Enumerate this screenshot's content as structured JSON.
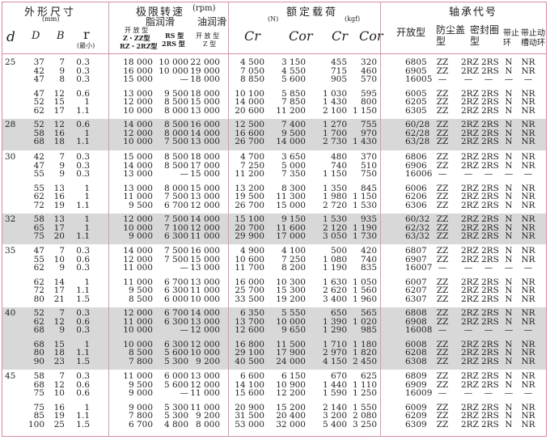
{
  "header": {
    "dims_title": "外形尺寸",
    "dims_unit": "(mm)",
    "d": "d",
    "D": "D",
    "B": "B",
    "r": "r",
    "r_note": "(最小)",
    "speed_title": "极限转速",
    "speed_unit": "(rpm)",
    "grease": "脂润滑",
    "oil": "油润滑",
    "grease_open": "开 放 型",
    "grease_zz": "Z・ZZ型",
    "grease_rz": "RZ・2RZ型",
    "rs_type": "RS 型",
    "rs2_type": "2RS 型",
    "oil_open": "开 放 型",
    "oil_z": "Z 型",
    "load_title": "额定载荷",
    "load_unit_n": "(N)",
    "load_unit_kgf": "(kgf)",
    "cr": "Cr",
    "cor": "Cor",
    "cr2": "Cr",
    "cor2": "Cor",
    "code_title": "轴承代号",
    "open_type": "开放型",
    "dust_cover": "防尘盖型",
    "seal_ring": "密封圈型",
    "snap_ring": "带止环",
    "snap_groove": "带止动槽动环"
  },
  "groups": [
    {
      "d": "25",
      "rows": [
        [
          "37",
          "7",
          "0.3",
          "18 000",
          "10 000",
          "22 000",
          "4 500",
          "3 150",
          "455",
          "320",
          "6805",
          "ZZ",
          "2RZ",
          "2RS",
          "N",
          "NR"
        ],
        [
          "42",
          "9",
          "0.3",
          "16 000",
          "10 000",
          "19 000",
          "7 050",
          "4 550",
          "715",
          "460",
          "6905",
          "ZZ",
          "2RZ",
          "2RS",
          "N",
          "NR"
        ],
        [
          "47",
          "8",
          "0.3",
          "15 000",
          "—",
          "18 000",
          "8 850",
          "5 600",
          "905",
          "570",
          "16005",
          "—",
          "—",
          "—",
          "—",
          "—"
        ],
        [
          "47",
          "12",
          "0.6",
          "13 000",
          "9 500",
          "18 000",
          "10 100",
          "5 850",
          "1 030",
          "595",
          "6005",
          "ZZ",
          "2RZ",
          "2RS",
          "N",
          "NR"
        ],
        [
          "52",
          "15",
          "1",
          "12 000",
          "8 500",
          "15 000",
          "14 000",
          "7 850",
          "1 430",
          "800",
          "6205",
          "ZZ",
          "2RZ",
          "2RS",
          "N",
          "NR"
        ],
        [
          "62",
          "17",
          "1.1",
          "10 000",
          "8 000",
          "13 000",
          "20 600",
          "11 200",
          "2 100",
          "1 150",
          "6305",
          "ZZ",
          "2RZ",
          "2RS",
          "N",
          "NR"
        ]
      ]
    },
    {
      "d": "28",
      "rows": [
        [
          "52",
          "12",
          "0.6",
          "14 000",
          "8 500",
          "16 000",
          "12 500",
          "7 400",
          "1 270",
          "755",
          "60/28",
          "ZZ",
          "2RZ",
          "2RS",
          "N",
          "NR"
        ],
        [
          "58",
          "16",
          "1",
          "12 000",
          "8 000",
          "14 000",
          "16 600",
          "9 500",
          "1 700",
          "970",
          "62/28",
          "ZZ",
          "2RZ",
          "2RS",
          "N",
          "NR"
        ],
        [
          "68",
          "18",
          "1.1",
          "10 000",
          "7 500",
          "13 000",
          "26 700",
          "14 000",
          "2 730",
          "1 430",
          "63/28",
          "ZZ",
          "2RZ",
          "2RS",
          "N",
          "NR"
        ]
      ]
    },
    {
      "d": "30",
      "rows": [
        [
          "42",
          "7",
          "0.3",
          "15 000",
          "8 500",
          "18 000",
          "4 700",
          "3 650",
          "480",
          "370",
          "6806",
          "ZZ",
          "2RZ",
          "2RS",
          "N",
          "NR"
        ],
        [
          "47",
          "9",
          "0.3",
          "14 000",
          "8 500",
          "17 000",
          "7 250",
          "5 000",
          "740",
          "510",
          "6906",
          "ZZ",
          "2RZ",
          "2RS",
          "N",
          "NR"
        ],
        [
          "55",
          "9",
          "0.3",
          "13 000",
          "—",
          "15 000",
          "11 200",
          "7 350",
          "1 150",
          "750",
          "16006",
          "—",
          "—",
          "—",
          "—",
          "—"
        ],
        [
          "55",
          "13",
          "1",
          "13 000",
          "8 000",
          "15 000",
          "13 200",
          "8 300",
          "1 350",
          "845",
          "6006",
          "ZZ",
          "2RZ",
          "2RS",
          "N",
          "NR"
        ],
        [
          "62",
          "16",
          "1",
          "11 000",
          "7 500",
          "13 000",
          "19 500",
          "11 300",
          "1 980",
          "1 150",
          "6206",
          "ZZ",
          "2RZ",
          "2RS",
          "N",
          "NR"
        ],
        [
          "72",
          "19",
          "1.1",
          "9 500",
          "6 700",
          "12 000",
          "26 700",
          "15 000",
          "2 720",
          "1 530",
          "6306",
          "ZZ",
          "2RZ",
          "2RS",
          "N",
          "NR"
        ]
      ]
    },
    {
      "d": "32",
      "rows": [
        [
          "58",
          "13",
          "1",
          "12 000",
          "7 500",
          "14 000",
          "15 100",
          "9 150",
          "1 530",
          "935",
          "60/32",
          "ZZ",
          "2RZ",
          "2RS",
          "N",
          "NR"
        ],
        [
          "65",
          "17",
          "1",
          "10 000",
          "7 100",
          "12 000",
          "20 700",
          "11 600",
          "2 120",
          "1 190",
          "62/32",
          "ZZ",
          "2RZ",
          "2RS",
          "N",
          "NR"
        ],
        [
          "75",
          "20",
          "1.1",
          "9 000",
          "6 300",
          "11 000",
          "29 900",
          "17 000",
          "3 050",
          "1 730",
          "63/32",
          "ZZ",
          "2RZ",
          "2RS",
          "N",
          "NR"
        ]
      ]
    },
    {
      "d": "35",
      "rows": [
        [
          "47",
          "7",
          "0.3",
          "14 000",
          "7 500",
          "16 000",
          "4 900",
          "4 100",
          "500",
          "420",
          "6807",
          "ZZ",
          "2RZ",
          "2RS",
          "N",
          "NR"
        ],
        [
          "55",
          "10",
          "0.6",
          "12 000",
          "7 500",
          "15 000",
          "10 600",
          "7 250",
          "1 080",
          "740",
          "6907",
          "ZZ",
          "2RZ",
          "2RS",
          "N",
          "NR"
        ],
        [
          "62",
          "9",
          "0.3",
          "11 000",
          "—",
          "13 000",
          "11 700",
          "8 200",
          "1 190",
          "835",
          "16007",
          "—",
          "—",
          "—",
          "—",
          "—"
        ],
        [
          "62",
          "14",
          "1",
          "11 000",
          "6 700",
          "13 000",
          "16 000",
          "10 300",
          "1 630",
          "1 050",
          "6007",
          "ZZ",
          "2RZ",
          "2RS",
          "N",
          "NR"
        ],
        [
          "72",
          "17",
          "1.1",
          "9 500",
          "6 300",
          "11 000",
          "25 700",
          "15 300",
          "2 620",
          "1 560",
          "6207",
          "ZZ",
          "2RZ",
          "2RS",
          "N",
          "NR"
        ],
        [
          "80",
          "21",
          "1.5",
          "8 500",
          "6 000",
          "10 000",
          "33 500",
          "19 200",
          "3 400",
          "1 960",
          "6307",
          "ZZ",
          "2RZ",
          "2RS",
          "N",
          "NR"
        ]
      ]
    },
    {
      "d": "40",
      "rows": [
        [
          "52",
          "7",
          "0.3",
          "12 000",
          "6 700",
          "14 000",
          "6 350",
          "5 550",
          "650",
          "565",
          "6808",
          "ZZ",
          "2RZ",
          "2RS",
          "N",
          "NR"
        ],
        [
          "62",
          "12",
          "0.6",
          "11 000",
          "6 300",
          "13 000",
          "13 700",
          "10 000",
          "1 390",
          "1 020",
          "6908",
          "ZZ",
          "2RZ",
          "2RS",
          "N",
          "NR"
        ],
        [
          "68",
          "9",
          "0.3",
          "10 000",
          "—",
          "12 000",
          "12 600",
          "9 650",
          "1 290",
          "985",
          "16008",
          "—",
          "—",
          "—",
          "—",
          "—"
        ],
        [
          "68",
          "15",
          "1",
          "10 000",
          "6 300",
          "12 000",
          "16 800",
          "11 500",
          "1 710",
          "1 180",
          "6008",
          "ZZ",
          "2RZ",
          "2RS",
          "N",
          "NR"
        ],
        [
          "80",
          "18",
          "1.1",
          "8 500",
          "5 600",
          "10 000",
          "29 100",
          "17 900",
          "2 970",
          "1 820",
          "6208",
          "ZZ",
          "2RZ",
          "2RS",
          "N",
          "NR"
        ],
        [
          "90",
          "23",
          "1.5",
          "7 800",
          "5 300",
          "9 200",
          "40 500",
          "24 000",
          "4 150",
          "2 450",
          "6308",
          "ZZ",
          "2RZ",
          "2RS",
          "N",
          "NR"
        ]
      ]
    },
    {
      "d": "45",
      "rows": [
        [
          "58",
          "7",
          "0.3",
          "11 000",
          "6 000",
          "13 000",
          "6 600",
          "6 150",
          "670",
          "625",
          "6809",
          "ZZ",
          "2RZ",
          "2RS",
          "N",
          "NR"
        ],
        [
          "68",
          "12",
          "0.6",
          "9 500",
          "5 600",
          "12 000",
          "14 100",
          "10 900",
          "1 440",
          "1 110",
          "6909",
          "ZZ",
          "2RZ",
          "2RS",
          "N",
          "NR"
        ],
        [
          "75",
          "10",
          "0.6",
          "9 000",
          "—",
          "11 000",
          "15 600",
          "12 200",
          "1 590",
          "1 250",
          "16009",
          "—",
          "—",
          "—",
          "—",
          "—"
        ],
        [
          "75",
          "16",
          "1",
          "9 000",
          "5 300",
          "11 000",
          "20 900",
          "15 200",
          "2 140",
          "1 550",
          "6009",
          "ZZ",
          "2RZ",
          "2RS",
          "N",
          "NR"
        ],
        [
          "85",
          "19",
          "1.1",
          "7 800",
          "5 300",
          "9 200",
          "31 500",
          "20 400",
          "3 200",
          "2 080",
          "6209",
          "ZZ",
          "2RZ",
          "2RS",
          "N",
          "NR"
        ],
        [
          "100",
          "25",
          "1.5",
          "6 700",
          "4 800",
          "8 000",
          "53 000",
          "32 000",
          "5 400",
          "3 250",
          "6309",
          "ZZ",
          "2RZ",
          "2RS",
          "N",
          "NR"
        ]
      ]
    }
  ]
}
